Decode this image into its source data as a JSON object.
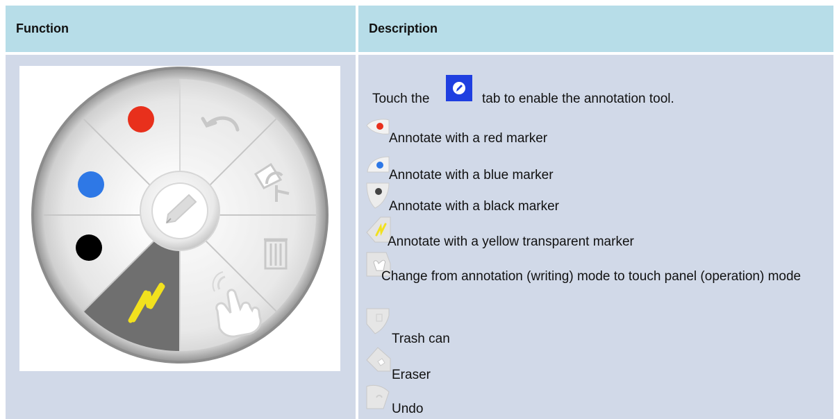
{
  "header": {
    "function_label": "Function",
    "description_label": "Description"
  },
  "wheel_icons": [
    "red-marker-icon",
    "undo-icon",
    "eraser-icon",
    "trash-icon",
    "touch-hand-icon",
    "yellow-marker-icon",
    "black-marker-icon",
    "blue-marker-icon",
    "pen-center-icon"
  ],
  "description": {
    "intro_before": "Touch the",
    "intro_after": "tab to enable the annotation tool.",
    "items": [
      {
        "icon": "red-marker-icon",
        "text": "Annotate with a red marker"
      },
      {
        "icon": "blue-marker-icon",
        "text": "Annotate with a blue marker"
      },
      {
        "icon": "black-marker-icon",
        "text": "Annotate with a black marker"
      },
      {
        "icon": "yellow-marker-icon",
        "text": "Annotate with a yellow transparent marker"
      },
      {
        "icon": "touch-mode-icon",
        "text": "Change from annotation (writing) mode to touch panel (operation) mode"
      },
      {
        "icon": "trash-icon",
        "text": "Trash can"
      },
      {
        "icon": "eraser-icon",
        "text": "Eraser"
      },
      {
        "icon": "undo-icon",
        "text": "Undo"
      }
    ]
  },
  "colors": {
    "header_bg": "#b7dde8",
    "body_bg": "#d1d9e8",
    "red": "#e8301c",
    "blue": "#2e78e6",
    "black": "#000000",
    "yellow": "#f2e11e",
    "tab_blue": "#1f3fe0"
  }
}
